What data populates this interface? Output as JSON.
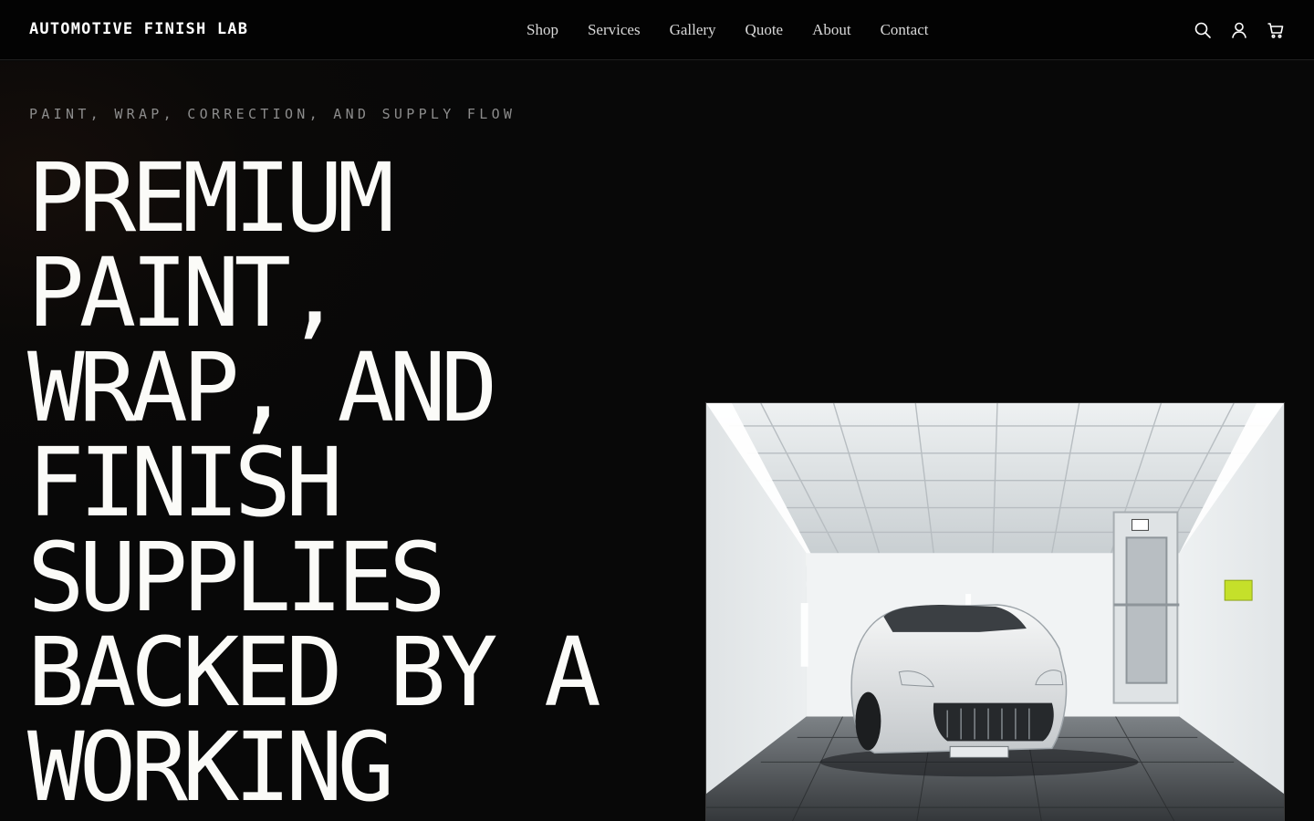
{
  "brand": {
    "name": "AUTOMOTIVE FINISH LAB"
  },
  "nav": {
    "items": [
      {
        "label": "Shop"
      },
      {
        "label": "Services"
      },
      {
        "label": "Gallery"
      },
      {
        "label": "Quote"
      },
      {
        "label": "About"
      },
      {
        "label": "Contact"
      }
    ]
  },
  "actions": {
    "icons": [
      "search-icon",
      "user-icon",
      "cart-icon"
    ]
  },
  "hero": {
    "eyebrow": "PAINT, WRAP, CORRECTION, AND SUPPLY FLOW",
    "headline_lines": [
      "PREMIUM",
      "PAINT,",
      "WRAP, AND",
      "FINISH",
      "SUPPLIES",
      "BACKED BY A",
      "WORKING"
    ]
  },
  "colors": {
    "background": "#080808",
    "header": "#030303",
    "text": "#fbfbf8",
    "muted": "#8c8c8c",
    "accent_panel": "#c5e02a"
  }
}
